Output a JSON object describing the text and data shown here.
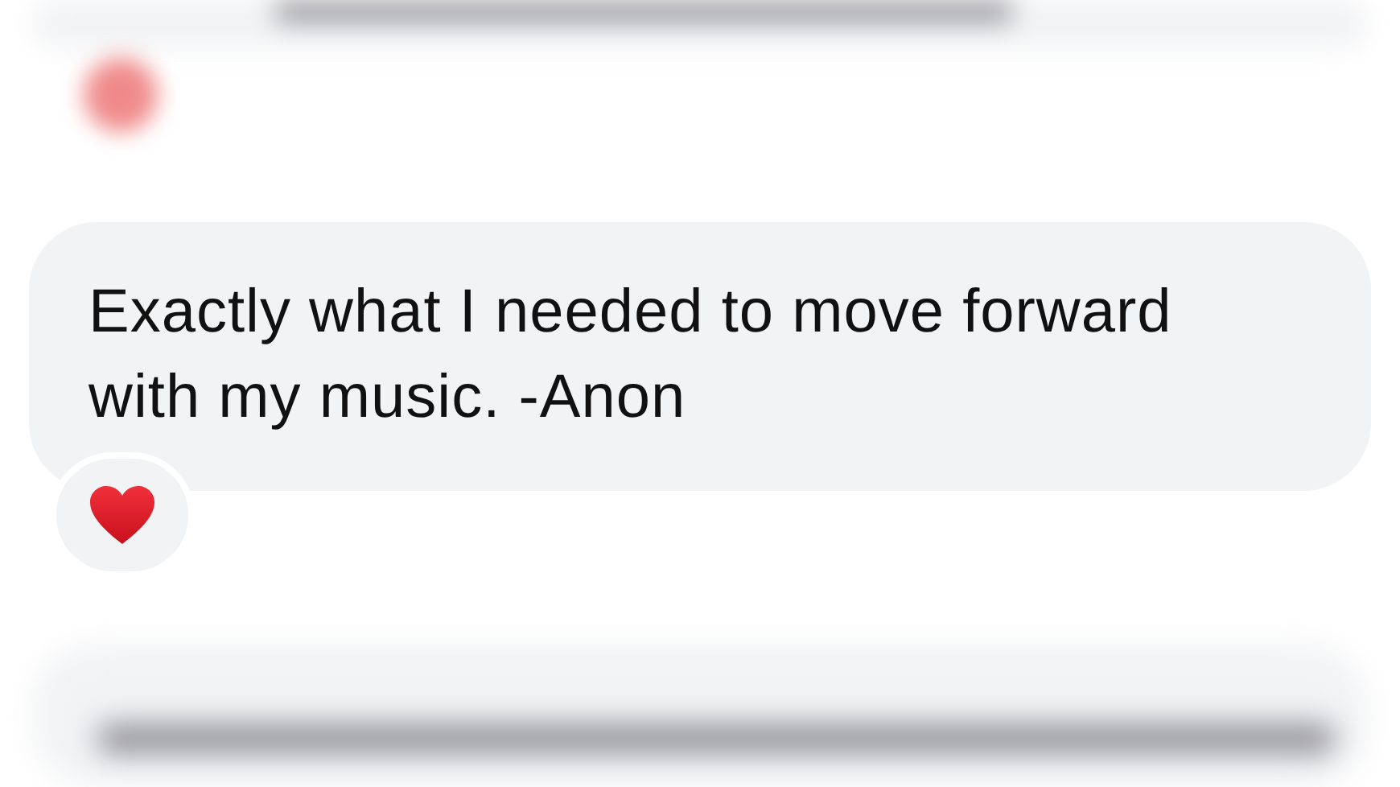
{
  "message": {
    "text": "Exactly what I needed to move forward with my music. -Anon"
  }
}
